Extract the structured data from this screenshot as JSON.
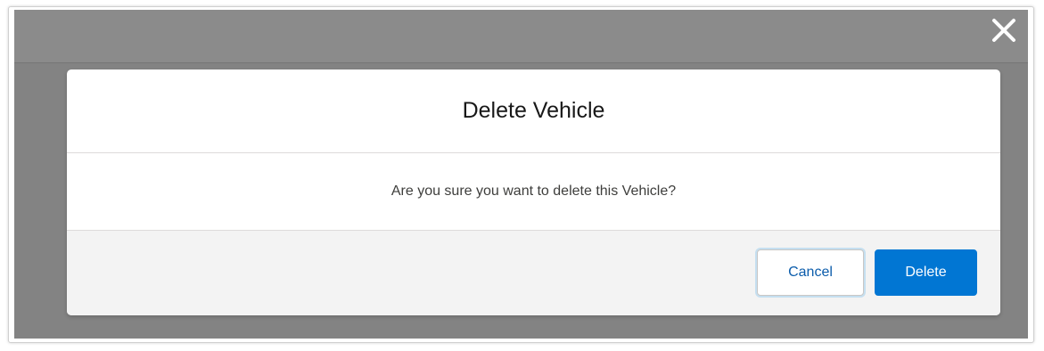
{
  "modal": {
    "title": "Delete Vehicle",
    "message": "Are you sure you want to delete this Vehicle?",
    "buttons": {
      "cancel_label": "Cancel",
      "delete_label": "Delete"
    },
    "close_icon": "close-icon"
  },
  "colors": {
    "brand_button": "#0176d3",
    "backdrop": "#838383",
    "footer_background": "#f3f3f3"
  }
}
